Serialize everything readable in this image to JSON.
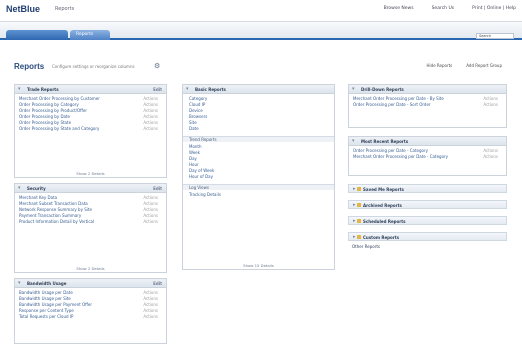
{
  "app": {
    "logo": "NetBlue",
    "logo_sub": "Reports",
    "top_links": [
      "Browse News",
      "Search Us",
      "Print | Online | Help"
    ]
  },
  "nav": {
    "tab1": "",
    "tab2": "Reports",
    "search_placeholder": "Search"
  },
  "header": {
    "title": "Reports",
    "desc": "Configure settings or reorganize columns",
    "actions": [
      "Hide Reports",
      "Add Report Group"
    ]
  },
  "panels": {
    "trade": {
      "title": "Trade Reports",
      "opt": "Edit",
      "items": [
        {
          "label": "Merchant Order Processing by Customer",
          "act": "Actions"
        },
        {
          "label": "Order Processing by Category",
          "act": "Actions"
        },
        {
          "label": "Order Processing by Product/Offer",
          "act": "Actions"
        },
        {
          "label": "Order Processing by Date",
          "act": "Actions"
        },
        {
          "label": "Order Processing by State",
          "act": "Actions"
        },
        {
          "label": "Order Processing by State and Category",
          "act": "Actions"
        }
      ],
      "foot": "Show 2 Details"
    },
    "security": {
      "title": "Security",
      "opt": "Edit",
      "items": [
        {
          "label": "Merchant Key Data",
          "act": "Actions"
        },
        {
          "label": "Merchant Subset Transaction Data",
          "act": "Actions"
        },
        {
          "label": "Network Response Summary by Site",
          "act": "Actions"
        },
        {
          "label": "Payment Transaction Summary",
          "act": "Actions"
        },
        {
          "label": "Product Information Detail by Vertical",
          "act": "Actions"
        }
      ],
      "foot": "Show 2 Details"
    },
    "bandwidth": {
      "title": "Bandwidth Usage",
      "opt": "Edit",
      "items": [
        {
          "label": "Bandwidth Usage per Date",
          "act": "Actions"
        },
        {
          "label": "Bandwidth Usage per Site",
          "act": "Actions"
        },
        {
          "label": "Bandwidth Usage per Payment Offer",
          "act": "Actions"
        },
        {
          "label": "Response per Content Type",
          "act": "Actions"
        },
        {
          "label": "Total Requests per Cloud IP",
          "act": "Actions"
        }
      ]
    },
    "basic": {
      "title": "Basic Reports",
      "items1": [
        "Category",
        "Cloud IP",
        "Device",
        "Browsers",
        "Site",
        "Date"
      ],
      "grp2": "Trend Reports",
      "items2": [
        "Month",
        "Week",
        "Day",
        "Hour",
        "Day of Week",
        "Hour of Day"
      ],
      "grp3": "Log Views",
      "items3": [
        "Tracking Details"
      ],
      "foot": "Show 15 Details"
    },
    "drill": {
      "title": "Drill-Down Reports",
      "items": [
        {
          "label": "Merchant Order Processing per Date - By Site",
          "act": "Actions"
        },
        {
          "label": "Order Processing per Date - Sort Order",
          "act": "Actions"
        }
      ]
    },
    "mostrecent": {
      "title": "Most Recent Reports",
      "items": [
        {
          "label": "Order Processing per Date - Category",
          "act": "Actions"
        },
        {
          "label": "Merchant Order Processing per Date - Category",
          "act": "Actions"
        }
      ]
    },
    "collapsed": [
      "Saved Me Reports",
      "Archived Reports",
      "Scheduled Reports",
      "Custom Reports"
    ],
    "other_label": "Other Reports"
  }
}
